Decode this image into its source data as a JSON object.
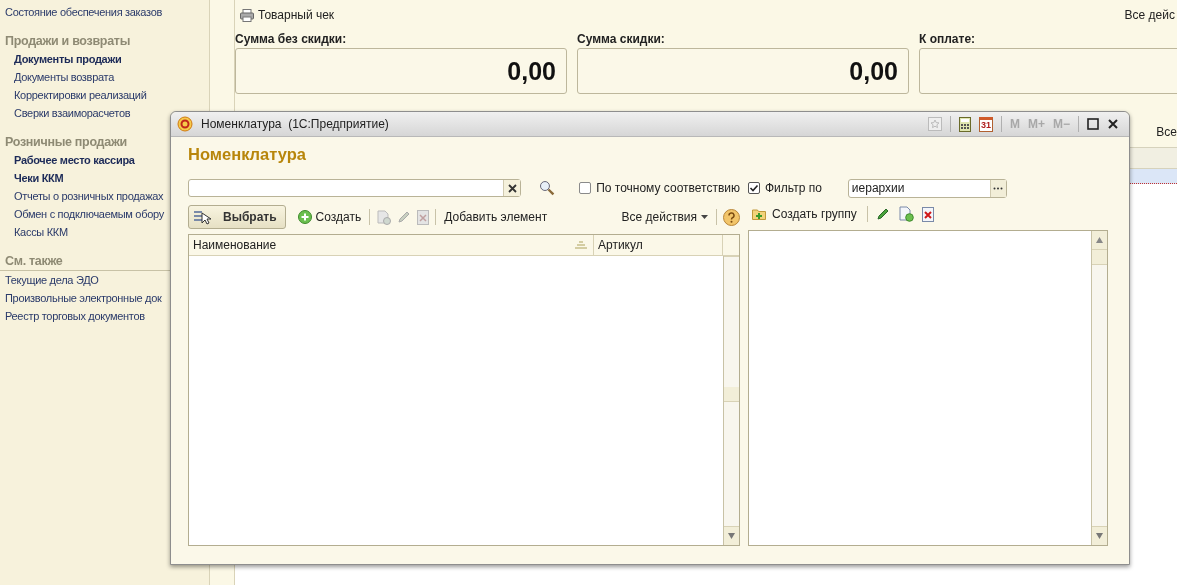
{
  "sidebar": {
    "sections": [
      {
        "items": [
          {
            "label": "Состояние обеспечения заказов",
            "important": false
          }
        ]
      },
      {
        "title": "Продажи и возвраты",
        "items": [
          {
            "label": "Документы продажи",
            "important": true
          },
          {
            "label": "Документы возврата",
            "important": false
          },
          {
            "label": "Корректировки реализаций",
            "important": false
          },
          {
            "label": "Сверки взаиморасчетов",
            "important": false
          }
        ]
      },
      {
        "title": "Розничные продажи",
        "items": [
          {
            "label": "Рабочее место кассира",
            "important": true
          },
          {
            "label": "Чеки ККМ",
            "important": true
          },
          {
            "label": "Отчеты о розничных продажах",
            "important": false
          },
          {
            "label": "Обмен с подключаемым обору",
            "important": false
          },
          {
            "label": "Кассы ККМ",
            "important": false
          }
        ]
      }
    ],
    "see_also": {
      "title": "См. также",
      "items": [
        "Текущие дела ЭДО",
        "Произвольные электронные док",
        "Реестр торговых документов"
      ]
    }
  },
  "document": {
    "print_button": "Товарный чек",
    "all_actions": "Все дейс",
    "totals": [
      {
        "label": "Сумма без скидки:",
        "value": "0,00"
      },
      {
        "label": "Сумма скидки:",
        "value": "0,00"
      },
      {
        "label": "К оплате:"
      }
    ],
    "table_all_actions": "Все",
    "table": {
      "rows": [
        {
          "selected": true
        }
      ]
    }
  },
  "dialog": {
    "title": "Номенклатура  (1С:Предприятие)",
    "calendar_day": "31",
    "memory_buttons": [
      "M",
      "M+",
      "M−"
    ],
    "heading": "Номенклатура",
    "exact_match": {
      "label": "По точному соответствию",
      "checked": false
    },
    "filter": {
      "label": "Фильтр по",
      "checked": true,
      "value": "иерархии"
    },
    "toolbar": {
      "select": "Выбрать",
      "create": "Создать",
      "add_element": "Добавить элемент",
      "all_actions": "Все действия"
    },
    "group_toolbar": {
      "create_group": "Создать группу"
    },
    "list": {
      "columns": [
        "Наименование",
        "Артикул"
      ]
    }
  }
}
